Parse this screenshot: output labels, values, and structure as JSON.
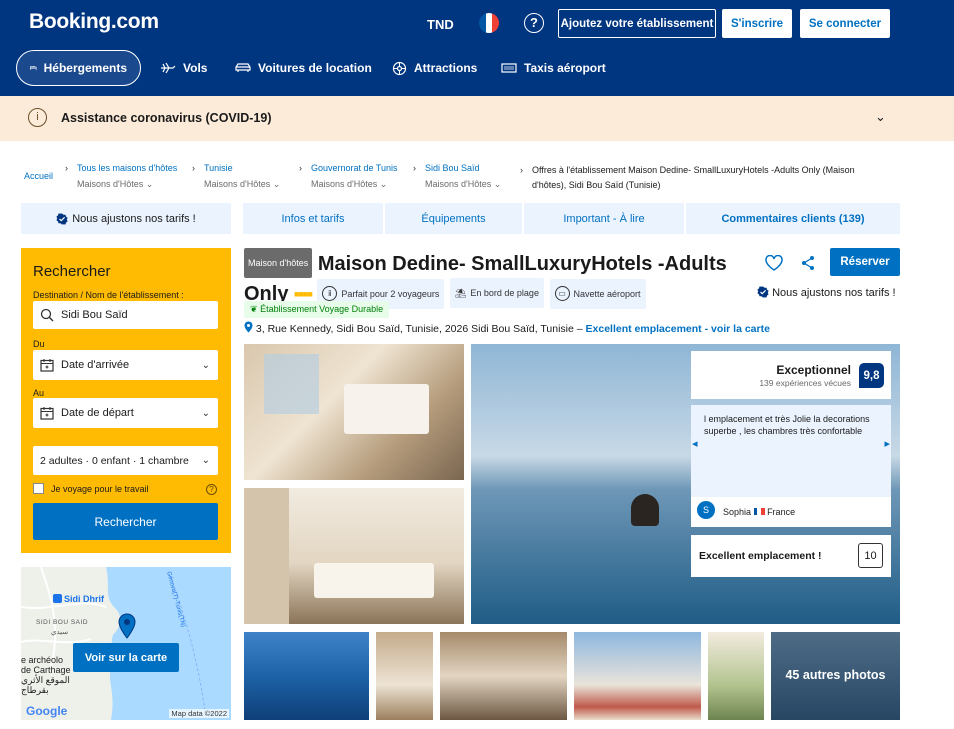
{
  "header": {
    "logo": "Booking.com",
    "currency": "TND",
    "help": "?",
    "add_property": "Ajoutez votre établissement",
    "register": "S'inscrire",
    "sign_in": "Se connecter",
    "nav": [
      {
        "label": "Hébergements",
        "icon": "bed-icon"
      },
      {
        "label": "Vols",
        "icon": "plane-icon"
      },
      {
        "label": "Voitures de location",
        "icon": "car-icon"
      },
      {
        "label": "Attractions",
        "icon": "attractions-icon"
      },
      {
        "label": "Taxis aéroport",
        "icon": "taxi-icon"
      }
    ]
  },
  "covid": {
    "text": "Assistance coronavirus (COVID-19)"
  },
  "breadcrumb": {
    "home": "Accueil",
    "items": [
      {
        "label": "Tous les maisons d'hôtes",
        "sub": "Maisons d'Hôtes"
      },
      {
        "label": "Tunisie",
        "sub": "Maisons d'Hôtes"
      },
      {
        "label": "Gouvernorat de Tunis",
        "sub": "Maisons d'Hôtes"
      },
      {
        "label": "Sidi Bou Saïd",
        "sub": "Maisons d'Hôtes"
      }
    ],
    "current": "Offres à l'établissement Maison Dedine- SmallLuxuryHotels -Adults Only (Maison d'hôtes), Sidi Bou Saïd (Tunisie)"
  },
  "tabs": {
    "price_note": "Nous ajustons nos tarifs !",
    "items": [
      "Infos et tarifs",
      "Équipements",
      "Important - À lire",
      "Commentaires clients (139)"
    ]
  },
  "search": {
    "title": "Rechercher",
    "destination_label": "Destination / Nom de l'établissement :",
    "destination_value": "Sidi Bou Saïd",
    "from_label": "Du",
    "checkin": "Date d'arrivée",
    "to_label": "Au",
    "checkout": "Date de départ",
    "guests": "2 adultes · 0 enfant · 1 chambre",
    "work_travel": "Je voyage pour le travail",
    "button": "Rechercher"
  },
  "map": {
    "label1": "Sidi Dhrif",
    "label2": "SIDI BOU SAID",
    "label2_ar": "سيدي",
    "label3": "e archéolo",
    "label4": "de Carthage",
    "label4_ar": "الموقع الأثري",
    "label5_ar": "بقرطاج",
    "road": "Génova(T)-Tunis(TN)",
    "button": "Voir sur la carte",
    "google": "Google",
    "attribution": "Map data ©2022"
  },
  "property": {
    "type": "Maison d'hôtes",
    "name": "Maison Dedine- SmallLuxuryHotels -Adults Only",
    "stars": 4,
    "chips": [
      "Parfait pour 2 voyageurs",
      "En bord de plage",
      "Navette aéroport"
    ],
    "eco": "Établissement Voyage Durable",
    "address": "3, Rue Kennedy, Sidi Bou Saïd, Tunisie, 2026 Sidi Bou Saïd, Tunisie –",
    "location_link": "Excellent emplacement - voir la carte",
    "reserve": "Réserver",
    "price_note": "Nous ajustons nos tarifs !"
  },
  "review": {
    "label": "Exceptionnel",
    "count": "139 expériences vécues",
    "score": "9,8",
    "quote": "l emplacement et très Jolie la decorations superbe , les chambres très confortable",
    "author_initial": "S",
    "author": "Sophia",
    "country": "France",
    "location_label": "Excellent emplacement !",
    "location_score": "10"
  },
  "photos": {
    "more": "45 autres photos"
  },
  "colors": {
    "brand": "#003580",
    "accent": "#0071c2",
    "yellow": "#febb02"
  }
}
